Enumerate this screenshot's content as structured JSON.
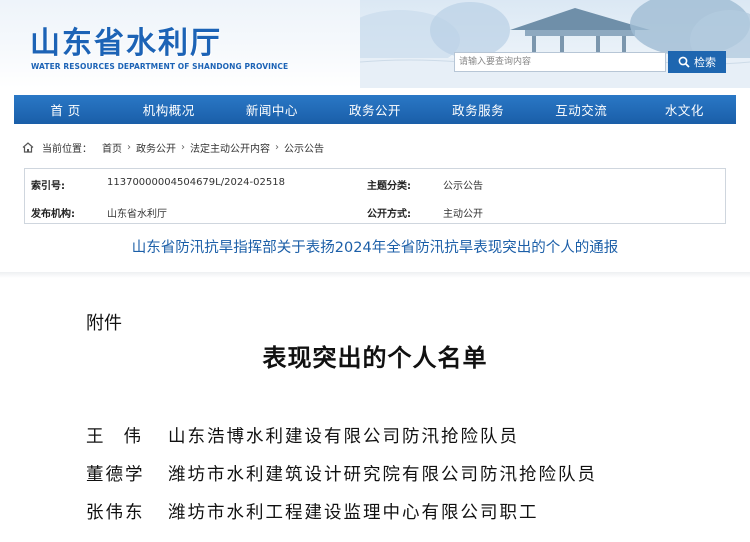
{
  "header": {
    "site_title": "山东省水利厅",
    "site_subtitle": "WATER RESOURCES DEPARTMENT OF SHANDONG PROVINCE",
    "search_placeholder": "请输入要查询内容",
    "search_button_label": "检索"
  },
  "nav": {
    "items": [
      "首 页",
      "机构概况",
      "新闻中心",
      "政务公开",
      "政务服务",
      "互动交流",
      "水文化"
    ]
  },
  "breadcrumb": {
    "label": "当前位置：",
    "items": [
      "首页",
      "政务公开",
      "法定主动公开内容",
      "公示公告"
    ]
  },
  "meta": {
    "index_label": "索引号:",
    "index_value": "11370000004504679L/2024-02518",
    "topic_label": "主题分类:",
    "topic_value": "公示公告",
    "issuer_label": "发布机构:",
    "issuer_value": "山东省水利厅",
    "disclosure_label": "公开方式:",
    "disclosure_value": "主动公开"
  },
  "article": {
    "title": "山东省防汛抗旱指挥部关于表扬2024年全省防汛抗旱表现突出的个人的通报"
  },
  "attachment": {
    "label": "附件",
    "title": "表现突出的个人名单",
    "people": [
      {
        "name": "王伟",
        "desc": "山东浩博水利建设有限公司防汛抢险队员"
      },
      {
        "name": "董德学",
        "desc": "潍坊市水利建筑设计研究院有限公司防汛抢险队员"
      },
      {
        "name": "张伟东",
        "desc": "潍坊市水利工程建设监理中心有限公司职工"
      }
    ]
  },
  "colors": {
    "brand_blue": "#1c63b6",
    "nav_blue": "#1e66b0",
    "title_blue": "#1c5fa8"
  }
}
